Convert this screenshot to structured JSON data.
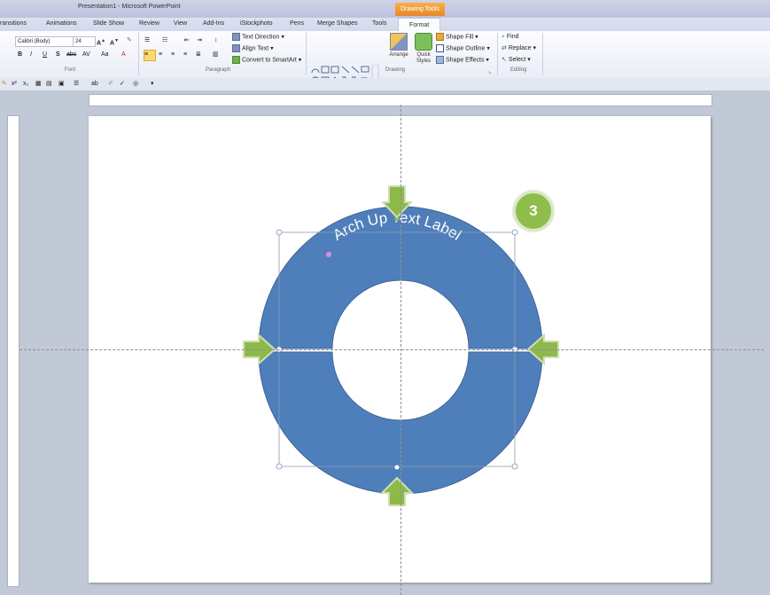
{
  "window": {
    "title": "Presentation1 - Microsoft PowerPoint",
    "context_header": "Drawing Tools"
  },
  "tabs": [
    {
      "label": "ransitions"
    },
    {
      "label": "Animations"
    },
    {
      "label": "Slide Show"
    },
    {
      "label": "Review"
    },
    {
      "label": "View"
    },
    {
      "label": "Add-Ins"
    },
    {
      "label": "iStockphoto"
    },
    {
      "label": "Pens"
    },
    {
      "label": "Merge Shapes"
    },
    {
      "label": "Tools"
    },
    {
      "label": "Format",
      "active": true
    }
  ],
  "ribbon": {
    "font": {
      "name": "Calibri (Body)",
      "size": "24",
      "group_label": "Font"
    },
    "paragraph": {
      "text_direction": "Text Direction",
      "align_text": "Align Text",
      "convert_smartart": "Convert to SmartArt",
      "group_label": "Paragraph"
    },
    "drawing": {
      "arrange": "Arrange",
      "quick_styles_line1": "Quick",
      "quick_styles_line2": "Styles",
      "shape_fill": "Shape Fill",
      "shape_outline": "Shape Outline",
      "shape_effects": "Shape Effects",
      "group_label": "Drawing"
    },
    "editing": {
      "find": "Find",
      "replace": "Replace",
      "select": "Select",
      "group_label": "Editing"
    }
  },
  "slide": {
    "arch_text": "Arch Up Text Label",
    "step_badge": "3",
    "shape_color": "#4f7fba",
    "arrow_color": "#8fb84b"
  }
}
